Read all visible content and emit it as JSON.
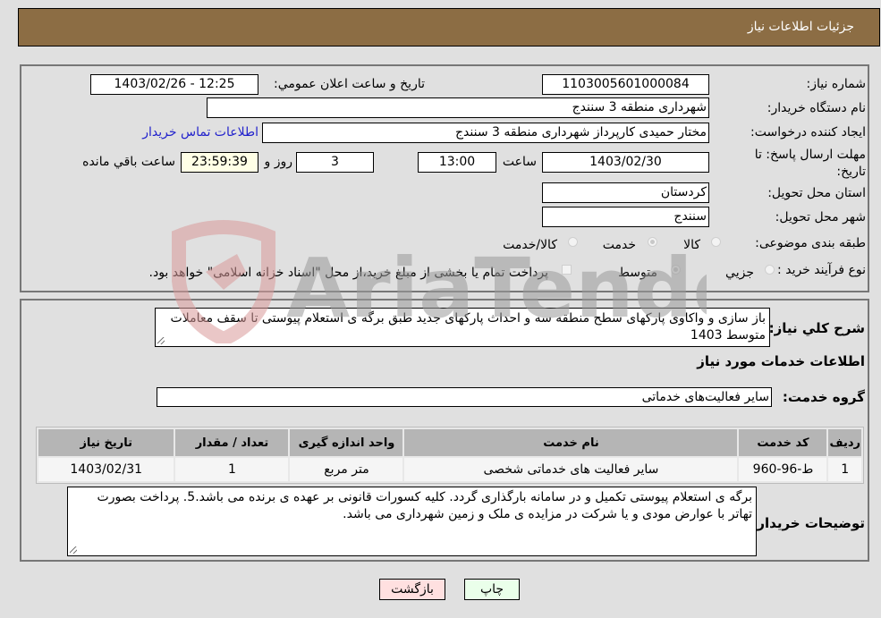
{
  "header": {
    "title": "جزئیات اطلاعات نیاز"
  },
  "details": {
    "need_number": {
      "label": "شماره نیاز:",
      "value": "1103005601000084"
    },
    "announce_datetime": {
      "label": "تاریخ و ساعت اعلان عمومي:",
      "value": "1403/02/26 - 12:25"
    },
    "buyer_org": {
      "label": "نام دستگاه خريدار:",
      "value": "شهرداری منطقه 3 سنندج"
    },
    "requester": {
      "label": "ایجاد کننده درخواست:",
      "value": "مختار حمیدی کارپرداز شهرداری منطقه 3 سنندج"
    },
    "buyer_contact_link": "اطلاعات تماس خريدار",
    "deadline": {
      "label": "مهلت ارسال پاسخ: تا تاریخ:",
      "date": "1403/02/30",
      "time_label": "ساعت",
      "time": "13:00",
      "days": "3",
      "days_label": "روز و",
      "remaining": "23:59:39",
      "remaining_label": "ساعت باقي مانده"
    },
    "province": {
      "label": "استان محل تحویل:",
      "value": "کردستان"
    },
    "city": {
      "label": "شهر محل تحویل:",
      "value": "سنندج"
    },
    "category": {
      "label": "طبقه بندی موضوعی:",
      "options": [
        {
          "label": "کالا",
          "checked": false
        },
        {
          "label": "خدمت",
          "checked": true
        },
        {
          "label": "کالا/خدمت",
          "checked": false
        }
      ]
    },
    "purchase_type": {
      "label": "نوع فرآیند خرید :",
      "options": [
        {
          "label": "جزيي",
          "checked": false
        },
        {
          "label": "متوسط",
          "checked": true
        }
      ],
      "treasury_note": "پرداخت تمام یا بخشی از مبلغ خرید،از محل \"اسناد خزانه اسلامی\" خواهد بود."
    }
  },
  "description": {
    "label": "شرح کلي نياز:",
    "value": "باز سازی و واکاوی پارکهای سطح منطقه سه و احداث پارکهای جدید طبق برگه ی استعلام پیوستی تا سقف معاملات متوسط 1403"
  },
  "services_section_title": "اطلاعات خدمات مورد نیاز",
  "service_group": {
    "label": "گروه خدمت:",
    "value": "سایر فعالیت‌های خدماتی"
  },
  "services_table": {
    "columns": [
      "رديف",
      "کد خدمت",
      "نام خدمت",
      "واحد اندازه گیری",
      "تعداد / مقدار",
      "تاریخ نیاز"
    ],
    "rows": [
      [
        "1",
        "ط-96-960",
        "سایر فعالیت های خدماتی شخصی",
        "متر مربع",
        "1",
        "1403/02/31"
      ]
    ]
  },
  "buyer_notes": {
    "label": "توضیحات خریدار:",
    "value": "برگه ی استعلام پیوستی تکمیل و در سامانه بارگذاری گردد. کلیه کسورات قانونی بر عهده ی برنده می باشد.5. پرداخت بصورت تهاتر با عوارض مودی و یا شرکت در مزایده ی ملک و زمین شهرداری می باشد."
  },
  "buttons": {
    "print": "چاپ",
    "back": "بازگشت"
  },
  "watermark": {
    "text": "AriaTender.neT"
  }
}
